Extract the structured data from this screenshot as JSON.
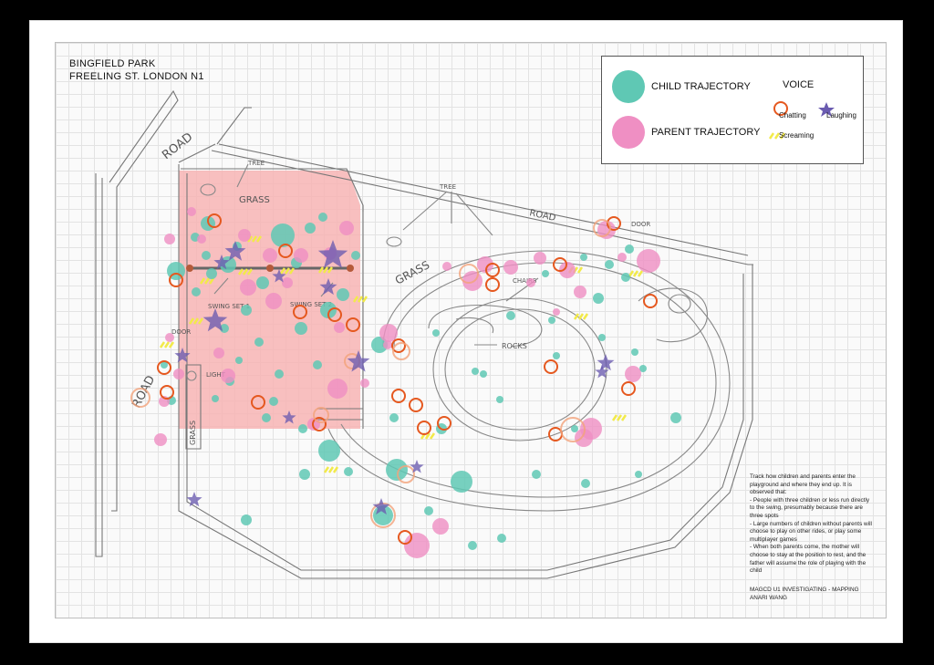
{
  "header": {
    "line1": "BINGFIELD PARK",
    "line2": "FREELING ST. LONDON N1"
  },
  "legend": {
    "child": "CHILD TRAJECTORY",
    "parent": "PARENT TRAJECTORY",
    "voice_title": "VOICE",
    "chatting": "Chatting",
    "laughing": "Laughing",
    "screaming": "Screaming"
  },
  "colors": {
    "child": "#5fc8b4",
    "parent": "#ef8fc3",
    "chatting": "#e5581f",
    "laughing": "#6a5bb0",
    "screaming": "#f2ea4a",
    "pink_zone": "#f7b4b4"
  },
  "sketch_labels": {
    "road_left_top": "ROAD",
    "road_top": "ROAD",
    "road_left": "ROAD",
    "tree1": "TREE",
    "tree2": "TREE",
    "grass1": "GRASS",
    "grass2": "GRASS",
    "grass3": "GRASS",
    "door1": "DOOR",
    "door2": "DOOR",
    "chairs": "CHAIRS",
    "rocks": "ROCKS",
    "light": "LIGHT",
    "swing1": "SWING SET 1",
    "swing2": "SWING SET 2"
  },
  "notes": {
    "intro": "Track how children and parents enter the playground and where they end up. It is observed that:",
    "points": [
      "- People with three children or less run directly to the swing, presumably because there are three spots",
      "- Large numbers of children without parents will choose to play on other rides, or play some multiplayer games",
      "- When both parents come, the mother will choose to stay at the position to rest, and the father will assume the role of playing with the child"
    ]
  },
  "credits": {
    "line1": "MAGCD U1 INVESTIGATING - MAPPING",
    "line2": "ANARI WANG"
  }
}
